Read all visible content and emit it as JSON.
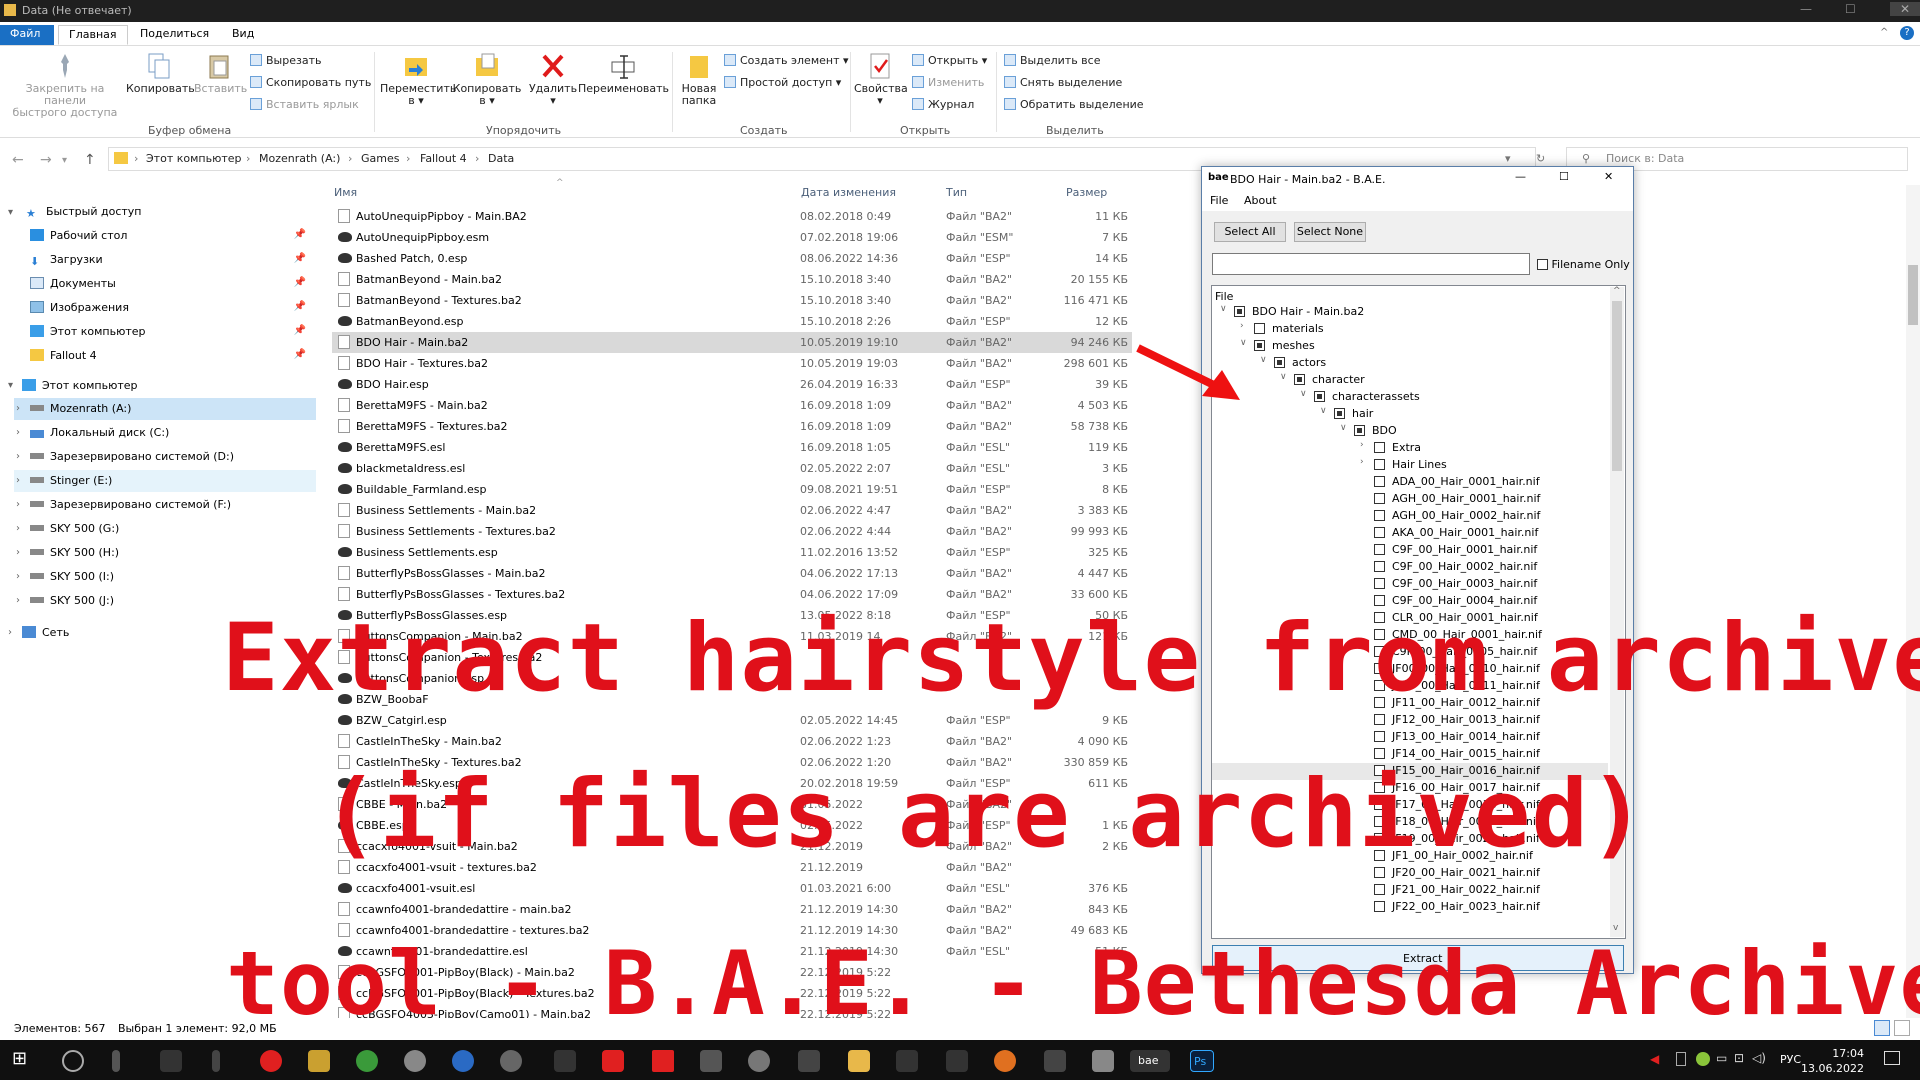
{
  "window": {
    "title": "Data (Не отвечает)"
  },
  "ribbon_tabs": [
    "Файл",
    "Главная",
    "Поделиться",
    "Вид"
  ],
  "ribbon": {
    "pin_label_1": "Закрепить на панели",
    "pin_label_2": "быстрого доступа",
    "copy": "Копировать",
    "paste": "Вставить",
    "cut": "Вырезать",
    "copy_path": "Скопировать путь",
    "paste_shortcut": "Вставить ярлык",
    "group_clipboard": "Буфер обмена",
    "move": "Переместить",
    "move_sub": "в ▾",
    "copy_to": "Копировать",
    "copy_to_sub": "в ▾",
    "delete": "Удалить",
    "delete_sub": "▾",
    "rename": "Переименовать",
    "group_organize": "Упорядочить",
    "new_folder_1": "Новая",
    "new_folder_2": "папка",
    "new_item": "Создать элемент ▾",
    "easy_access": "Простой доступ ▾",
    "group_new": "Создать",
    "properties": "Свойства",
    "properties_sub": "▾",
    "open": "Открыть ▾",
    "edit": "Изменить",
    "history": "Журнал",
    "group_open": "Открыть",
    "select_all": "Выделить все",
    "select_none": "Снять выделение",
    "invert": "Обратить выделение",
    "group_select": "Выделить"
  },
  "address": {
    "crumbs": [
      "Этот компьютер",
      "Mozenrath (A:)",
      "Games",
      "Fallout 4",
      "Data"
    ],
    "search_placeholder": "Поиск в: Data"
  },
  "nav_pane": {
    "quick_access": "Быстрый доступ",
    "quick_items": [
      "Рабочий стол",
      "Загрузки",
      "Документы",
      "Изображения",
      "Этот компьютер",
      "Fallout 4"
    ],
    "this_pc": "Этот компьютер",
    "drives": [
      "Mozenrath (A:)",
      "Локальный диск (C:)",
      "Зарезервировано системой (D:)",
      "Stinger (E:)",
      "Зарезервировано системой (F:)",
      "SKY 500 (G:)",
      "SKY 500 (H:)",
      "SKY 500 (I:)",
      "SKY 500 (J:)"
    ],
    "network": "Сеть"
  },
  "columns": {
    "name": "Имя",
    "date": "Дата изменения",
    "type": "Тип",
    "size": "Размер"
  },
  "files": [
    {
      "name": "AutoUnequipPipboy - Main.BA2",
      "date": "08.02.2018 0:49",
      "type": "Файл \"BA2\"",
      "size": "11 КБ",
      "kind": "doc"
    },
    {
      "name": "AutoUnequipPipboy.esm",
      "date": "07.02.2018 19:06",
      "type": "Файл \"ESM\"",
      "size": "7 КБ",
      "kind": "esp"
    },
    {
      "name": "Bashed Patch, 0.esp",
      "date": "08.06.2022 14:36",
      "type": "Файл \"ESP\"",
      "size": "14 КБ",
      "kind": "esp"
    },
    {
      "name": "BatmanBeyond - Main.ba2",
      "date": "15.10.2018 3:40",
      "type": "Файл \"BA2\"",
      "size": "20 155 КБ",
      "kind": "doc"
    },
    {
      "name": "BatmanBeyond - Textures.ba2",
      "date": "15.10.2018 3:40",
      "type": "Файл \"BA2\"",
      "size": "116 471 КБ",
      "kind": "doc"
    },
    {
      "name": "BatmanBeyond.esp",
      "date": "15.10.2018 2:26",
      "type": "Файл \"ESP\"",
      "size": "12 КБ",
      "kind": "esp"
    },
    {
      "name": "BDO Hair - Main.ba2",
      "date": "10.05.2019 19:10",
      "type": "Файл \"BA2\"",
      "size": "94 246 КБ",
      "kind": "doc",
      "selected": true
    },
    {
      "name": "BDO Hair - Textures.ba2",
      "date": "10.05.2019 19:03",
      "type": "Файл \"BA2\"",
      "size": "298 601 КБ",
      "kind": "doc"
    },
    {
      "name": "BDO Hair.esp",
      "date": "26.04.2019 16:33",
      "type": "Файл \"ESP\"",
      "size": "39 КБ",
      "kind": "esp"
    },
    {
      "name": "BerettaM9FS - Main.ba2",
      "date": "16.09.2018 1:09",
      "type": "Файл \"BA2\"",
      "size": "4 503 КБ",
      "kind": "doc"
    },
    {
      "name": "BerettaM9FS - Textures.ba2",
      "date": "16.09.2018 1:09",
      "type": "Файл \"BA2\"",
      "size": "58 738 КБ",
      "kind": "doc"
    },
    {
      "name": "BerettaM9FS.esl",
      "date": "16.09.2018 1:05",
      "type": "Файл \"ESL\"",
      "size": "119 КБ",
      "kind": "esp"
    },
    {
      "name": "blackmetaldress.esl",
      "date": "02.05.2022 2:07",
      "type": "Файл \"ESL\"",
      "size": "3 КБ",
      "kind": "esp"
    },
    {
      "name": "Buildable_Farmland.esp",
      "date": "09.08.2021 19:51",
      "type": "Файл \"ESP\"",
      "size": "8 КБ",
      "kind": "esp"
    },
    {
      "name": "Business Settlements - Main.ba2",
      "date": "02.06.2022 4:47",
      "type": "Файл \"BA2\"",
      "size": "3 383 КБ",
      "kind": "doc"
    },
    {
      "name": "Business Settlements - Textures.ba2",
      "date": "02.06.2022 4:44",
      "type": "Файл \"BA2\"",
      "size": "99 993 КБ",
      "kind": "doc"
    },
    {
      "name": "Business Settlements.esp",
      "date": "11.02.2016 13:52",
      "type": "Файл \"ESP\"",
      "size": "325 КБ",
      "kind": "esp"
    },
    {
      "name": "ButterflyPsBossGlasses - Main.ba2",
      "date": "04.06.2022 17:13",
      "type": "Файл \"BA2\"",
      "size": "4 447 КБ",
      "kind": "doc"
    },
    {
      "name": "ButterflyPsBossGlasses - Textures.ba2",
      "date": "04.06.2022 17:09",
      "type": "Файл \"BA2\"",
      "size": "33 600 КБ",
      "kind": "doc"
    },
    {
      "name": "ButterflyPsBossGlasses.esp",
      "date": "13.05.2022 8:18",
      "type": "Файл \"ESP\"",
      "size": "50 КБ",
      "kind": "esp"
    },
    {
      "name": "ButtonsCompanion - Main.ba2",
      "date": "11.03.2019 14",
      "type": "Файл \"BA2\"",
      "size": "121 КБ",
      "kind": "doc"
    },
    {
      "name": "ButtonsCompanion - Textures.ba2",
      "date": "",
      "type": "",
      "size": "",
      "kind": "doc"
    },
    {
      "name": "ButtonsCompanion.esp",
      "date": "",
      "type": "",
      "size": "",
      "kind": "esp"
    },
    {
      "name": "BZW_BoobaF",
      "date": "",
      "type": "",
      "size": "",
      "kind": "esp"
    },
    {
      "name": "BZW_Catgirl.esp",
      "date": "02.05.2022 14:45",
      "type": "Файл \"ESP\"",
      "size": "9 КБ",
      "kind": "esp"
    },
    {
      "name": "CastleInTheSky - Main.ba2",
      "date": "02.06.2022 1:23",
      "type": "Файл \"BA2\"",
      "size": "4 090 КБ",
      "kind": "doc"
    },
    {
      "name": "CastleInTheSky - Textures.ba2",
      "date": "02.06.2022 1:20",
      "type": "Файл \"BA2\"",
      "size": "330 859 КБ",
      "kind": "doc"
    },
    {
      "name": "CastleInTheSky.esp",
      "date": "20.02.2018 19:59",
      "type": "Файл \"ESP\"",
      "size": "611 КБ",
      "kind": "esp"
    },
    {
      "name": "CBBE - Main.ba2",
      "date": "31.05.2022",
      "type": "Файл \"BA2\"",
      "size": "",
      "kind": "doc"
    },
    {
      "name": "CBBE.esp",
      "date": "02.05.2022",
      "type": "Файл \"ESP\"",
      "size": "1 КБ",
      "kind": "esp"
    },
    {
      "name": "ccacxfo4001-vsuit - Main.ba2",
      "date": "21.12.2019",
      "type": "Файл \"BA2\"",
      "size": "2 КБ",
      "kind": "doc"
    },
    {
      "name": "ccacxfo4001-vsuit - textures.ba2",
      "date": "21.12.2019",
      "type": "Файл \"BA2\"",
      "size": "",
      "kind": "doc"
    },
    {
      "name": "ccacxfo4001-vsuit.esl",
      "date": "01.03.2021 6:00",
      "type": "Файл \"ESL\"",
      "size": "376 КБ",
      "kind": "esp"
    },
    {
      "name": "ccawnfo4001-brandedattire - main.ba2",
      "date": "21.12.2019 14:30",
      "type": "Файл \"BA2\"",
      "size": "843 КБ",
      "kind": "doc"
    },
    {
      "name": "ccawnfo4001-brandedattire - textures.ba2",
      "date": "21.12.2019 14:30",
      "type": "Файл \"BA2\"",
      "size": "49 683 КБ",
      "kind": "doc"
    },
    {
      "name": "ccawnfo4001-brandedattire.esl",
      "date": "21.12.2019 14:30",
      "type": "Файл \"ESL\"",
      "size": "51 КБ",
      "kind": "esp"
    },
    {
      "name": "ccBGSFO4001-PipBoy(Black) - Main.ba2",
      "date": "22.12.2019 5:22",
      "type": "",
      "size": "",
      "kind": "doc"
    },
    {
      "name": "ccBGSFO4001-PipBoy(Black) - Textures.ba2",
      "date": "22.12.2019 5:22",
      "type": "",
      "size": "",
      "kind": "doc"
    },
    {
      "name": "ccBGSFO4003-PipBoy(Camo01) - Main.ba2",
      "date": "22.12.2019 5:22",
      "type": "",
      "size": "",
      "kind": "doc"
    }
  ],
  "status": {
    "count": "Элементов: 567",
    "selected": "Выбран 1 элемент: 92,0 МБ"
  },
  "bae": {
    "title": "BDO Hair - Main.ba2 - B.A.E.",
    "menu": [
      "File",
      "About"
    ],
    "select_all": "Select All",
    "select_none": "Select None",
    "filename_only": "Filename Only",
    "column": "File",
    "extract": "Extract",
    "tree": [
      {
        "label": "BDO Hair - Main.ba2",
        "level": 0,
        "exp": "open",
        "cb": "part"
      },
      {
        "label": "materials",
        "level": 1,
        "exp": "closed",
        "cb": "none"
      },
      {
        "label": "meshes",
        "level": 1,
        "exp": "open",
        "cb": "part"
      },
      {
        "label": "actors",
        "level": 2,
        "exp": "open",
        "cb": "part"
      },
      {
        "label": "character",
        "level": 3,
        "exp": "open",
        "cb": "part"
      },
      {
        "label": "characterassets",
        "level": 4,
        "exp": "open",
        "cb": "part"
      },
      {
        "label": "hair",
        "level": 5,
        "exp": "open",
        "cb": "part"
      },
      {
        "label": "BDO",
        "level": 6,
        "exp": "open",
        "cb": "part"
      },
      {
        "label": "Extra",
        "level": 7,
        "exp": "closed",
        "cb": "none"
      },
      {
        "label": "Hair Lines",
        "level": 7,
        "exp": "closed",
        "cb": "none"
      },
      {
        "label": "ADA_00_Hair_0001_hair.nif",
        "level": 7,
        "exp": "",
        "cb": "none"
      },
      {
        "label": "AGH_00_Hair_0001_hair.nif",
        "level": 7,
        "exp": "",
        "cb": "none"
      },
      {
        "label": "AGH_00_Hair_0002_hair.nif",
        "level": 7,
        "exp": "",
        "cb": "none"
      },
      {
        "label": "AKA_00_Hair_0001_hair.nif",
        "level": 7,
        "exp": "",
        "cb": "none"
      },
      {
        "label": "C9F_00_Hair_0001_hair.nif",
        "level": 7,
        "exp": "",
        "cb": "none"
      },
      {
        "label": "C9F_00_Hair_0002_hair.nif",
        "level": 7,
        "exp": "",
        "cb": "none"
      },
      {
        "label": "C9F_00_Hair_0003_hair.nif",
        "level": 7,
        "exp": "",
        "cb": "none"
      },
      {
        "label": "C9F_00_Hair_0004_hair.nif",
        "level": 7,
        "exp": "",
        "cb": "none"
      },
      {
        "label": "CLR_00_Hair_0001_hair.nif",
        "level": 7,
        "exp": "",
        "cb": "none"
      },
      {
        "label": "CMD_00_Hair_0001_hair.nif",
        "level": 7,
        "exp": "",
        "cb": "none"
      },
      {
        "label": "C9F_00_Hair_0005_hair.nif",
        "level": 7,
        "exp": "",
        "cb": "none"
      },
      {
        "label": "JF00_00_Hair_0010_hair.nif",
        "level": 7,
        "exp": "",
        "cb": "none"
      },
      {
        "label": "JF10_00_Hair_0011_hair.nif",
        "level": 7,
        "exp": "",
        "cb": "none"
      },
      {
        "label": "JF11_00_Hair_0012_hair.nif",
        "level": 7,
        "exp": "",
        "cb": "none"
      },
      {
        "label": "JF12_00_Hair_0013_hair.nif",
        "level": 7,
        "exp": "",
        "cb": "none"
      },
      {
        "label": "JF13_00_Hair_0014_hair.nif",
        "level": 7,
        "exp": "",
        "cb": "none"
      },
      {
        "label": "JF14_00_Hair_0015_hair.nif",
        "level": 7,
        "exp": "",
        "cb": "none"
      },
      {
        "label": "JF15_00_Hair_0016_hair.nif",
        "level": 7,
        "exp": "",
        "cb": "none",
        "hl": true
      },
      {
        "label": "JF16_00_Hair_0017_hair.nif",
        "level": 7,
        "exp": "",
        "cb": "none"
      },
      {
        "label": "JF17_00_Hair_0018_hair.nif",
        "level": 7,
        "exp": "",
        "cb": "none"
      },
      {
        "label": "JF18_00_Hair_0019_hair.nif",
        "level": 7,
        "exp": "",
        "cb": "none"
      },
      {
        "label": "JF19_00_Hair_0020_hair.nif",
        "level": 7,
        "exp": "",
        "cb": "none"
      },
      {
        "label": "JF1_00_Hair_0002_hair.nif",
        "level": 7,
        "exp": "",
        "cb": "none"
      },
      {
        "label": "JF20_00_Hair_0021_hair.nif",
        "level": 7,
        "exp": "",
        "cb": "none"
      },
      {
        "label": "JF21_00_Hair_0022_hair.nif",
        "level": 7,
        "exp": "",
        "cb": "none"
      },
      {
        "label": "JF22_00_Hair_0023_hair.nif",
        "level": 7,
        "exp": "",
        "cb": "none"
      }
    ]
  },
  "caption": {
    "line1": "Extract hairstyle from archive",
    "line2": "(if files are archived)",
    "line3": "tool - B.A.E. - Bethesda Archive"
  },
  "taskbar": {
    "bae_label": "bae",
    "ps_label": "Ps",
    "lang": "РУС",
    "time": "17:04",
    "date": "13.06.2022"
  },
  "colors": {
    "accent": "#1a6fc4",
    "caption": "#e0101a",
    "selection": "#cce4f7"
  }
}
